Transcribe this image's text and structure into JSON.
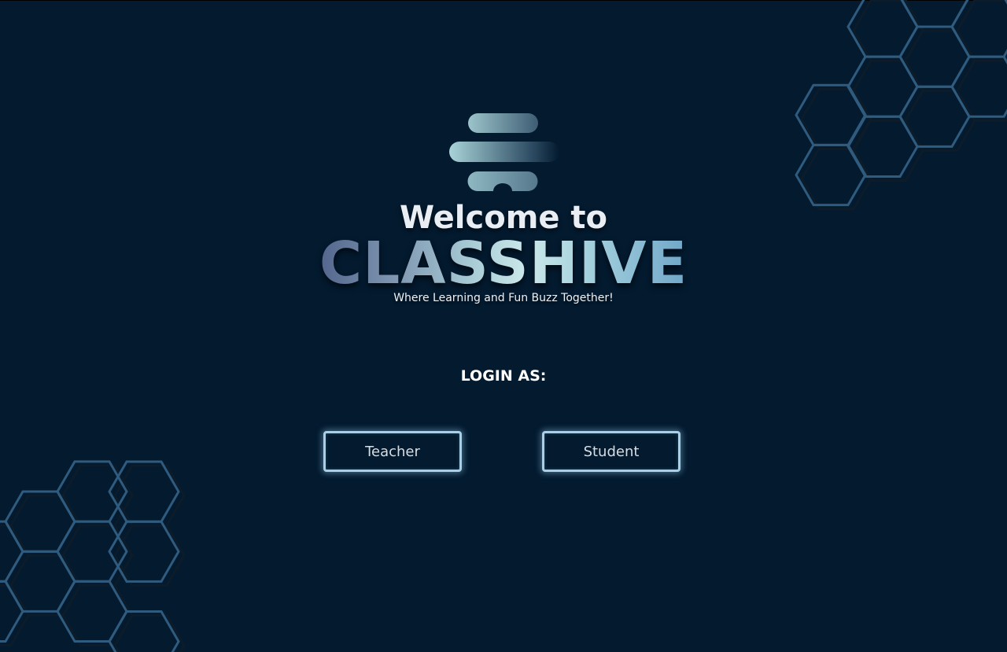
{
  "header": {
    "welcome_text": "Welcome to",
    "brand_name": "CLASSHIVE",
    "tagline": "Where Learning and Fun Buzz Together!"
  },
  "login": {
    "prompt": "LOGIN AS:",
    "roles": [
      {
        "label": "Teacher"
      },
      {
        "label": "Student"
      }
    ]
  },
  "icons": {
    "logo": "classhive-logo-icon",
    "decoration": "hexagon-pattern-icon"
  },
  "colors": {
    "background": "#031a2f",
    "hexagon_stroke": "#2f5b7e",
    "button_border": "#a9cfe6",
    "text_primary": "#ffffff",
    "brand_gradient_start": "#52648c",
    "brand_gradient_mid": "#cbe8ea",
    "brand_gradient_end": "#6fa6c8"
  }
}
